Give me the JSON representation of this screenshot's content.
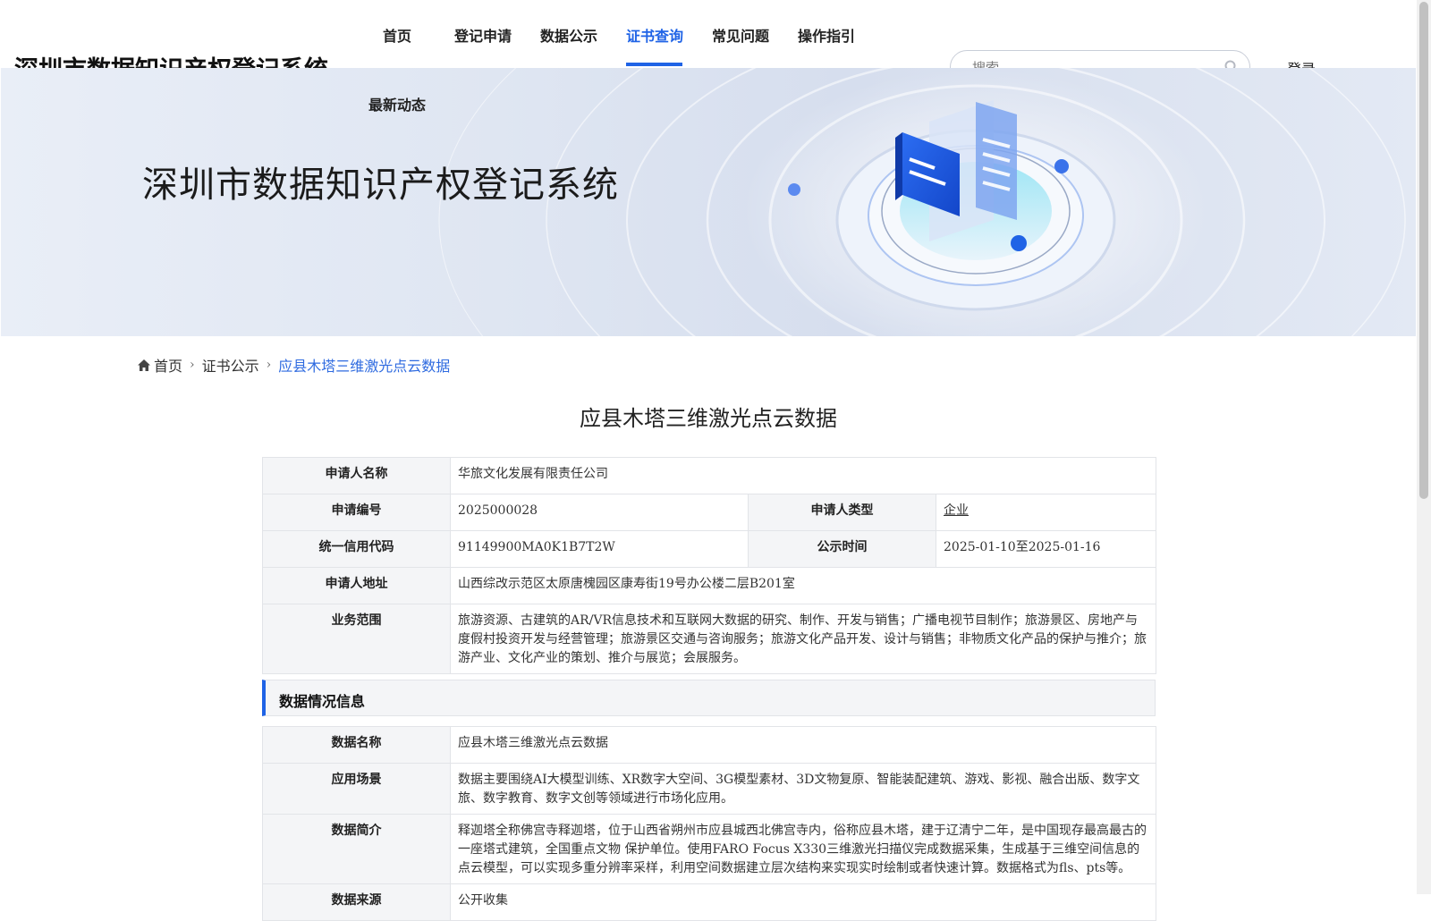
{
  "header": {
    "site_title": "深圳市数据知识产权登记系统",
    "nav": [
      {
        "label": "首页"
      },
      {
        "label": "登记申请"
      },
      {
        "label": "数据公示"
      },
      {
        "label": "证书查询",
        "active": true
      },
      {
        "label": "常见问题"
      },
      {
        "label": "操作指引"
      },
      {
        "label": "最新动态"
      }
    ],
    "search_placeholder": "搜索",
    "search_icon": "search-icon",
    "login_label": "登录",
    "accent_color": "#1f63e6"
  },
  "banner": {
    "title": "深圳市数据知识产权登记系统"
  },
  "breadcrumb": {
    "home_icon": "home-icon",
    "items": [
      "首页",
      "证书公示",
      "应县木塔三维激光点云数据"
    ]
  },
  "page_title": "应县木塔三维激光点云数据",
  "applicant_info": {
    "applicant_name_label": "申请人名称",
    "applicant_name": "华旅文化发展有限责任公司",
    "app_no_label": "申请编号",
    "app_no": "2025000028",
    "applicant_type_label": "申请人类型",
    "applicant_type": "企业",
    "credit_code_label": "统一信用代码",
    "credit_code": "91149900MA0K1B7T2W",
    "publicity_time_label": "公示时间",
    "publicity_time": "2025-01-10至2025-01-16",
    "address_label": "申请人地址",
    "address": "山西综改示范区太原唐槐园区康寿街19号办公楼二层B201室",
    "business_scope_label": "业务范围",
    "business_scope": "旅游资源、古建筑的AR/VR信息技术和互联网大数据的研究、制作、开发与销售；广播电视节目制作；旅游景区、房地产与度假村投资开发与经营管理；旅游景区交通与咨询服务；旅游文化产品开发、设计与销售；非物质文化产品的保护与推介；旅游产业、文化产业的策划、推介与展览；会展服务。"
  },
  "data_section": {
    "title": "数据情况信息",
    "data_name_label": "数据名称",
    "data_name": "应县木塔三维激光点云数据",
    "scenario_label": "应用场景",
    "scenario": "数据主要围绕AI大模型训练、XR数字大空间、3G模型素材、3D文物复原、智能装配建筑、游戏、影视、融合出版、数字文旅、数字教育、数字文创等领域进行市场化应用。",
    "intro_label": "数据简介",
    "intro": "释迦塔全称佛宫寺释迦塔，位于山西省朔州市应县城西北佛宫寺内，俗称应县木塔，建于辽清宁二年，是中国现存最高最古的一座塔式建筑，全国重点文物 保护单位。使用FARO Focus X330三维激光扫描仪完成数据采集，生成基于三维空间信息的点云模型，可以实现多重分辨率采样，利用空间数据建立层次结构来实现实时绘制或者快速计算。数据格式为fls、pts等。",
    "source_label": "数据来源",
    "source": "公开收集"
  }
}
